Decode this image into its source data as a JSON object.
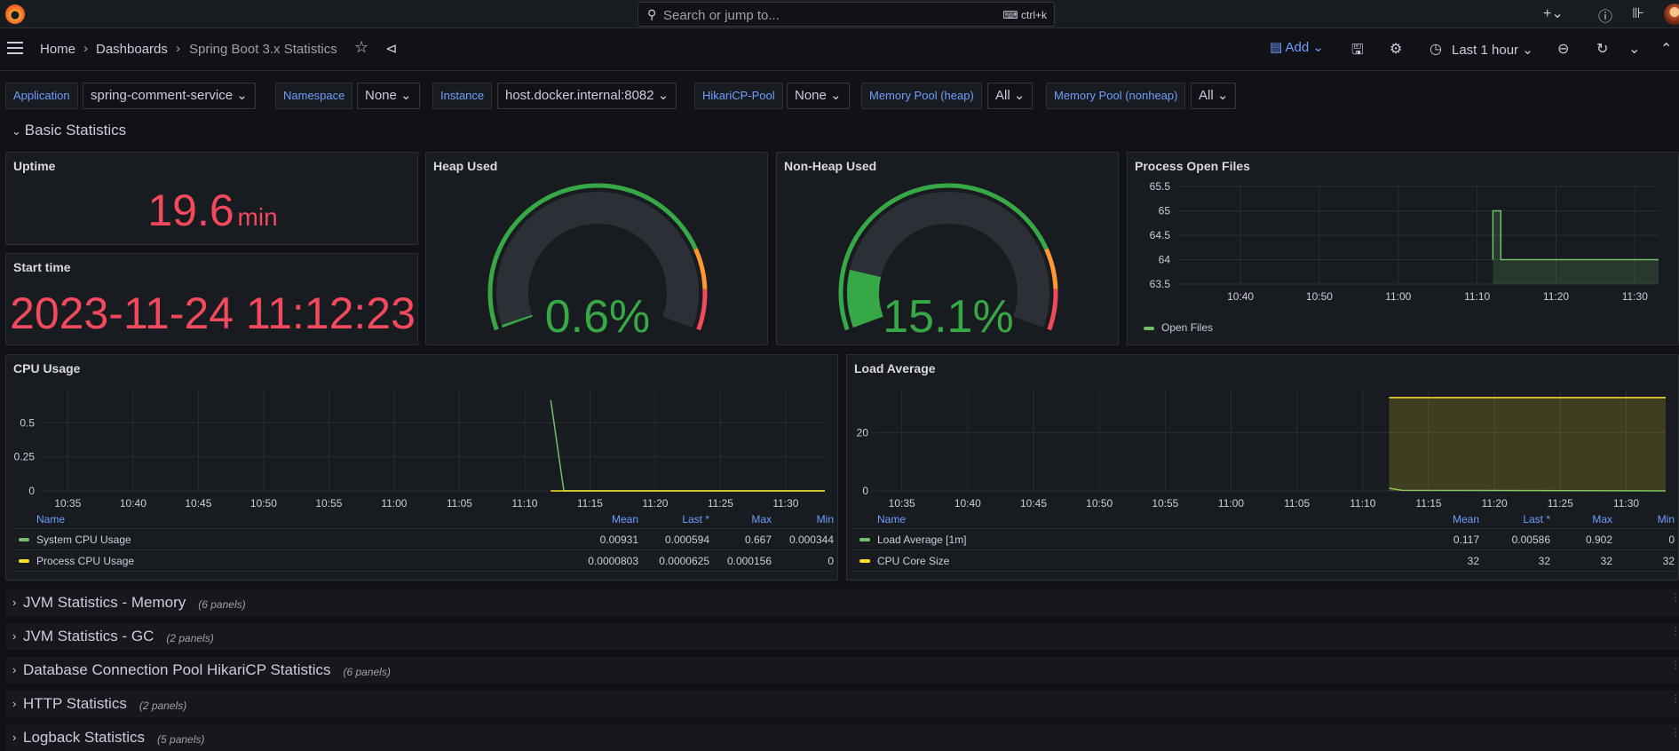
{
  "topbar": {
    "search_placeholder": "Search or jump to...",
    "shortcut": "ctrl+k",
    "icons": [
      "grafana-logo-icon",
      "search-icon",
      "keyboard-icon",
      "plus-icon",
      "help-icon",
      "news-icon",
      "avatar"
    ]
  },
  "nav": {
    "breadcrumbs": [
      "Home",
      "Dashboards",
      "Spring Boot 3.x Statistics"
    ],
    "add_label": "Add",
    "time_range": "Last 1 hour"
  },
  "variables": [
    {
      "label": "Application",
      "value": "spring-comment-service"
    },
    {
      "label": "Namespace",
      "value": "None"
    },
    {
      "label": "Instance",
      "value": "host.docker.internal:8082"
    },
    {
      "label": "HikariCP-Pool",
      "value": "None"
    },
    {
      "label": "Memory Pool (heap)",
      "value": "All"
    },
    {
      "label": "Memory Pool (nonheap)",
      "value": "All"
    }
  ],
  "basic_row": {
    "title": "Basic Statistics"
  },
  "panels": {
    "uptime": {
      "title": "Uptime",
      "value": "19.6",
      "unit": "min"
    },
    "start_time": {
      "title": "Start time",
      "value": "2023-11-24 11:12:23"
    },
    "heap": {
      "title": "Heap Used",
      "value": "0.6%",
      "percent": 0.6
    },
    "nonheap": {
      "title": "Non-Heap Used",
      "value": "15.1%",
      "percent": 15.1
    },
    "open_files": {
      "title": "Process Open Files",
      "legend": "Open Files"
    },
    "cpu": {
      "title": "CPU Usage",
      "legend_headers": [
        "Name",
        "Mean",
        "Last *",
        "Max",
        "Min"
      ],
      "rows": [
        {
          "name": "System CPU Usage",
          "color": "#73bf69",
          "mean": "0.00931",
          "last": "0.000594",
          "max": "0.667",
          "min": "0.000344"
        },
        {
          "name": "Process CPU Usage",
          "color": "#fade2a",
          "mean": "0.0000803",
          "last": "0.0000625",
          "max": "0.000156",
          "min": "0"
        }
      ]
    },
    "load": {
      "title": "Load Average",
      "legend_headers": [
        "Name",
        "Mean",
        "Last *",
        "Max",
        "Min"
      ],
      "rows": [
        {
          "name": "Load Average [1m]",
          "color": "#73bf69",
          "mean": "0.117",
          "last": "0.00586",
          "max": "0.902",
          "min": "0"
        },
        {
          "name": "CPU Core Size",
          "color": "#fade2a",
          "mean": "32",
          "last": "32",
          "max": "32",
          "min": "32"
        }
      ]
    }
  },
  "collapsed_rows": [
    {
      "title": "JVM Statistics - Memory",
      "count": "(6 panels)"
    },
    {
      "title": "JVM Statistics - GC",
      "count": "(2 panels)"
    },
    {
      "title": "Database Connection Pool HikariCP Statistics",
      "count": "(6 panels)"
    },
    {
      "title": "HTTP Statistics",
      "count": "(2 panels)"
    },
    {
      "title": "Logback Statistics",
      "count": "(5 panels)"
    }
  ],
  "chart_data": [
    {
      "type": "line",
      "title": "Process Open Files",
      "x_ticks": [
        "10:40",
        "10:50",
        "11:00",
        "11:10",
        "11:20",
        "11:30"
      ],
      "y_ticks": [
        "63.5",
        "64",
        "64.5",
        "65",
        "65.5"
      ],
      "ylim": [
        63.5,
        65.5
      ],
      "series": [
        {
          "name": "Open Files",
          "x": [
            "11:12",
            "11:12",
            "11:13",
            "11:13",
            "11:33"
          ],
          "values": [
            64,
            65,
            65,
            64,
            64
          ]
        }
      ]
    },
    {
      "type": "line",
      "title": "CPU Usage",
      "x_ticks": [
        "10:35",
        "10:40",
        "10:45",
        "10:50",
        "10:55",
        "11:00",
        "11:05",
        "11:10",
        "11:15",
        "11:20",
        "11:25",
        "11:30"
      ],
      "y_ticks": [
        "0",
        "0.25",
        "0.5"
      ],
      "ylim": [
        0,
        0.75
      ],
      "series": [
        {
          "name": "System CPU Usage",
          "x": [
            "11:12",
            "11:13",
            "11:33"
          ],
          "values": [
            0.667,
            0.001,
            0.0006
          ]
        },
        {
          "name": "Process CPU Usage",
          "x": [
            "11:12",
            "11:33"
          ],
          "values": [
            0.0001,
            0.0001
          ]
        }
      ]
    },
    {
      "type": "line",
      "title": "Load Average",
      "x_ticks": [
        "10:35",
        "10:40",
        "10:45",
        "10:50",
        "10:55",
        "11:00",
        "11:05",
        "11:10",
        "11:15",
        "11:20",
        "11:25",
        "11:30"
      ],
      "y_ticks": [
        "0",
        "20"
      ],
      "ylim": [
        0,
        35
      ],
      "series": [
        {
          "name": "Load Average [1m]",
          "x": [
            "11:12",
            "11:13",
            "11:33"
          ],
          "values": [
            0.9,
            0.2,
            0.006
          ]
        },
        {
          "name": "CPU Core Size",
          "x": [
            "11:12",
            "11:33"
          ],
          "values": [
            32,
            32
          ]
        }
      ]
    }
  ]
}
